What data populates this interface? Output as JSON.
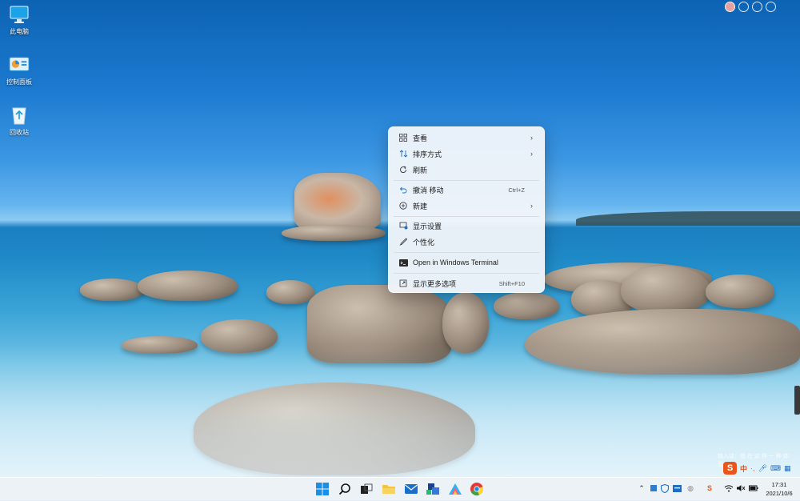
{
  "desktop": {
    "icons": [
      {
        "label": "此电脑",
        "icon": "computer-icon"
      },
      {
        "label": "控制面板",
        "icon": "control-panel-icon"
      },
      {
        "label": "回收站",
        "icon": "recycle-bin-icon"
      }
    ],
    "tray_tip": "输入法：就 在 这 样 一 种 体 验…"
  },
  "context_menu": {
    "items": [
      {
        "label": "查看",
        "icon": "view-grid-icon",
        "submenu": true
      },
      {
        "label": "排序方式",
        "icon": "sort-icon",
        "submenu": true
      },
      {
        "label": "刷新",
        "icon": "refresh-icon"
      },
      {
        "label": "撤消 移动",
        "icon": "undo-icon",
        "shortcut": "Ctrl+Z"
      },
      {
        "label": "新建",
        "icon": "new-plus-icon",
        "submenu": true
      },
      {
        "label": "显示设置",
        "icon": "display-settings-icon"
      },
      {
        "label": "个性化",
        "icon": "personalize-brush-icon"
      },
      {
        "label": "Open in Windows Terminal",
        "icon": "terminal-icon"
      },
      {
        "label": "显示更多选项",
        "icon": "more-options-icon",
        "shortcut": "Shift+F10"
      }
    ]
  },
  "ime": {
    "lang": "中",
    "punct": "·,"
  },
  "taskbar": {
    "apps": [
      "start-icon",
      "search-icon",
      "task-view-icon",
      "file-explorer-icon",
      "mail-icon",
      "store-icon",
      "photos-icon",
      "chrome-icon"
    ],
    "tray": [
      "chevron-up-icon",
      "app-tray-icon",
      "defender-icon",
      "ime-tray-icon",
      "sogou-icon",
      "wifi-icon",
      "volume-icon",
      "battery-icon"
    ],
    "clock": {
      "time": "17:31",
      "date": "2021/10/6"
    }
  },
  "colors": {
    "accent": "#0a66c2",
    "menu_bg": "#f2f6fa"
  }
}
